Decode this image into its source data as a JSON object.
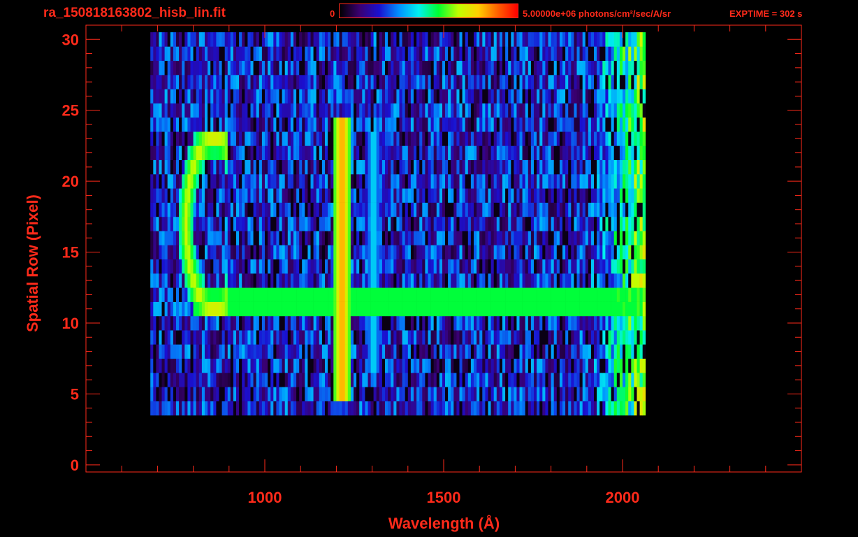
{
  "header": {
    "filename": "ra_150818163802_hisb_lin.fit",
    "colorbar_min": "0",
    "colorbar_max": "5.00000e+06 photons/cm²/sec/A/sr",
    "exptime": "EXPTIME = 302 s"
  },
  "colors": {
    "axis": "#ff2a1a",
    "background": "#000000",
    "colormap": [
      "#000000",
      "#3a0070",
      "#1a10d0",
      "#0090ff",
      "#00f0f0",
      "#00ff30",
      "#c0ff00",
      "#ffd000",
      "#ff6000",
      "#ff0000"
    ]
  },
  "chart_data": {
    "type": "heatmap",
    "title": "ra_150818163802_hisb_lin.fit",
    "xlabel": "Wavelength (Å)",
    "ylabel": "Spatial Row (Pixel)",
    "xlim": [
      500,
      2500
    ],
    "ylim": [
      -0.5,
      31
    ],
    "x_ticks": [
      1000,
      1500,
      2000
    ],
    "y_ticks": [
      0,
      5,
      10,
      15,
      20,
      25,
      30
    ],
    "colorbar_range": [
      0,
      5000000
    ],
    "colorbar_units": "photons/cm²/sec/A/sr",
    "detector_wavelength_range": [
      680,
      2060
    ],
    "features": [
      {
        "name": "1216 line",
        "wavelength": 1216,
        "rows": [
          5,
          24
        ],
        "intensity": 0.85
      },
      {
        "name": "1304 line",
        "wavelength": 1304,
        "rows": [
          7,
          23
        ],
        "intensity": 0.45
      },
      {
        "name": "spectrum trace",
        "wavelength_range": [
          800,
          2060
        ],
        "rows": [
          11,
          12
        ],
        "intensity": 0.55
      },
      {
        "name": "arc feature",
        "wavelength_range": [
          770,
          880
        ],
        "rows": [
          11,
          23
        ],
        "intensity": 0.7
      }
    ]
  }
}
